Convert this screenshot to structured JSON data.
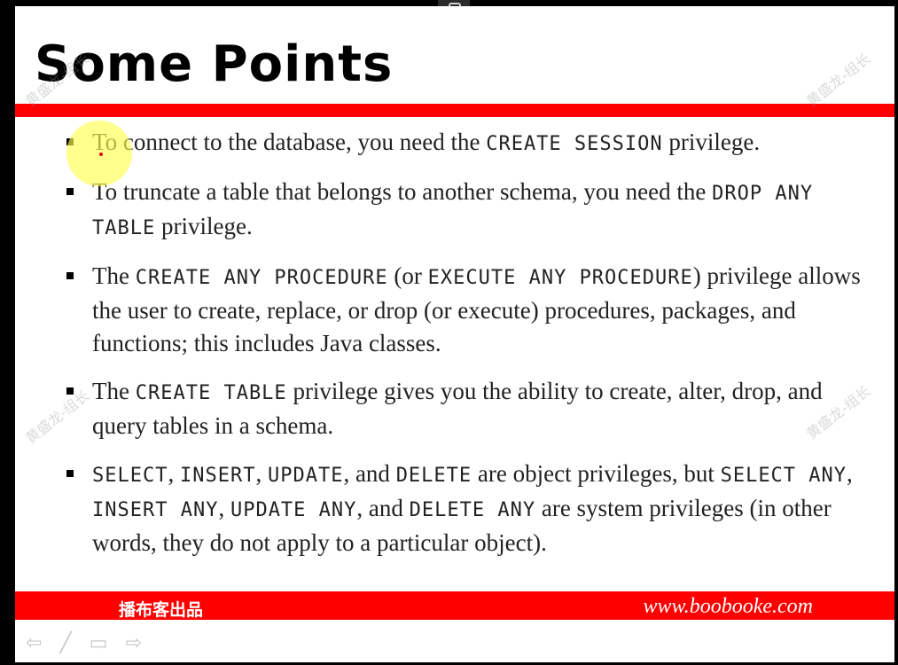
{
  "slide": {
    "title": "Some Points",
    "bullets": [
      [
        "To connect to the database, you need the ",
        {
          "c": "CREATE SESSION"
        },
        " privilege."
      ],
      [
        "To truncate a table that belongs to another schema, you need the ",
        {
          "c": "DROP ANY TABLE"
        },
        " privilege."
      ],
      [
        "The ",
        {
          "c": "CREATE ANY PROCEDURE"
        },
        " (or ",
        {
          "c": "EXECUTE ANY PROCEDURE"
        },
        ") privilege allows the user to create, replace, or drop (or execute) procedures, packages, and functions; this includes Java classes."
      ],
      [
        "The ",
        {
          "c": "CREATE TABLE"
        },
        " privilege gives you the ability to create, alter, drop, and query tables in a schema."
      ],
      [
        {
          "c": "SELECT"
        },
        ", ",
        {
          "c": "INSERT"
        },
        ", ",
        {
          "c": "UPDATE"
        },
        ", and ",
        {
          "c": "DELETE"
        },
        " are object privileges, but ",
        {
          "c": "SELECT ANY"
        },
        ", ",
        {
          "c": "INSERT ANY"
        },
        ", ",
        {
          "c": "UPDATE ANY"
        },
        ", and ",
        {
          "c": "DELETE ANY"
        },
        " are system privileges (in other words, they do not apply to a particular object)."
      ]
    ],
    "footer": {
      "brand": "播布客出品",
      "url": "www.boobooke.com"
    },
    "watermark": "黄盛龙-组长"
  },
  "nav": {
    "prev_icon": "⇦",
    "pen_icon": "╱",
    "menu_icon": "▭",
    "next_icon": "⇨"
  },
  "colors": {
    "accent_red": "#ff0000",
    "highlight_yellow": "#ffff50"
  }
}
